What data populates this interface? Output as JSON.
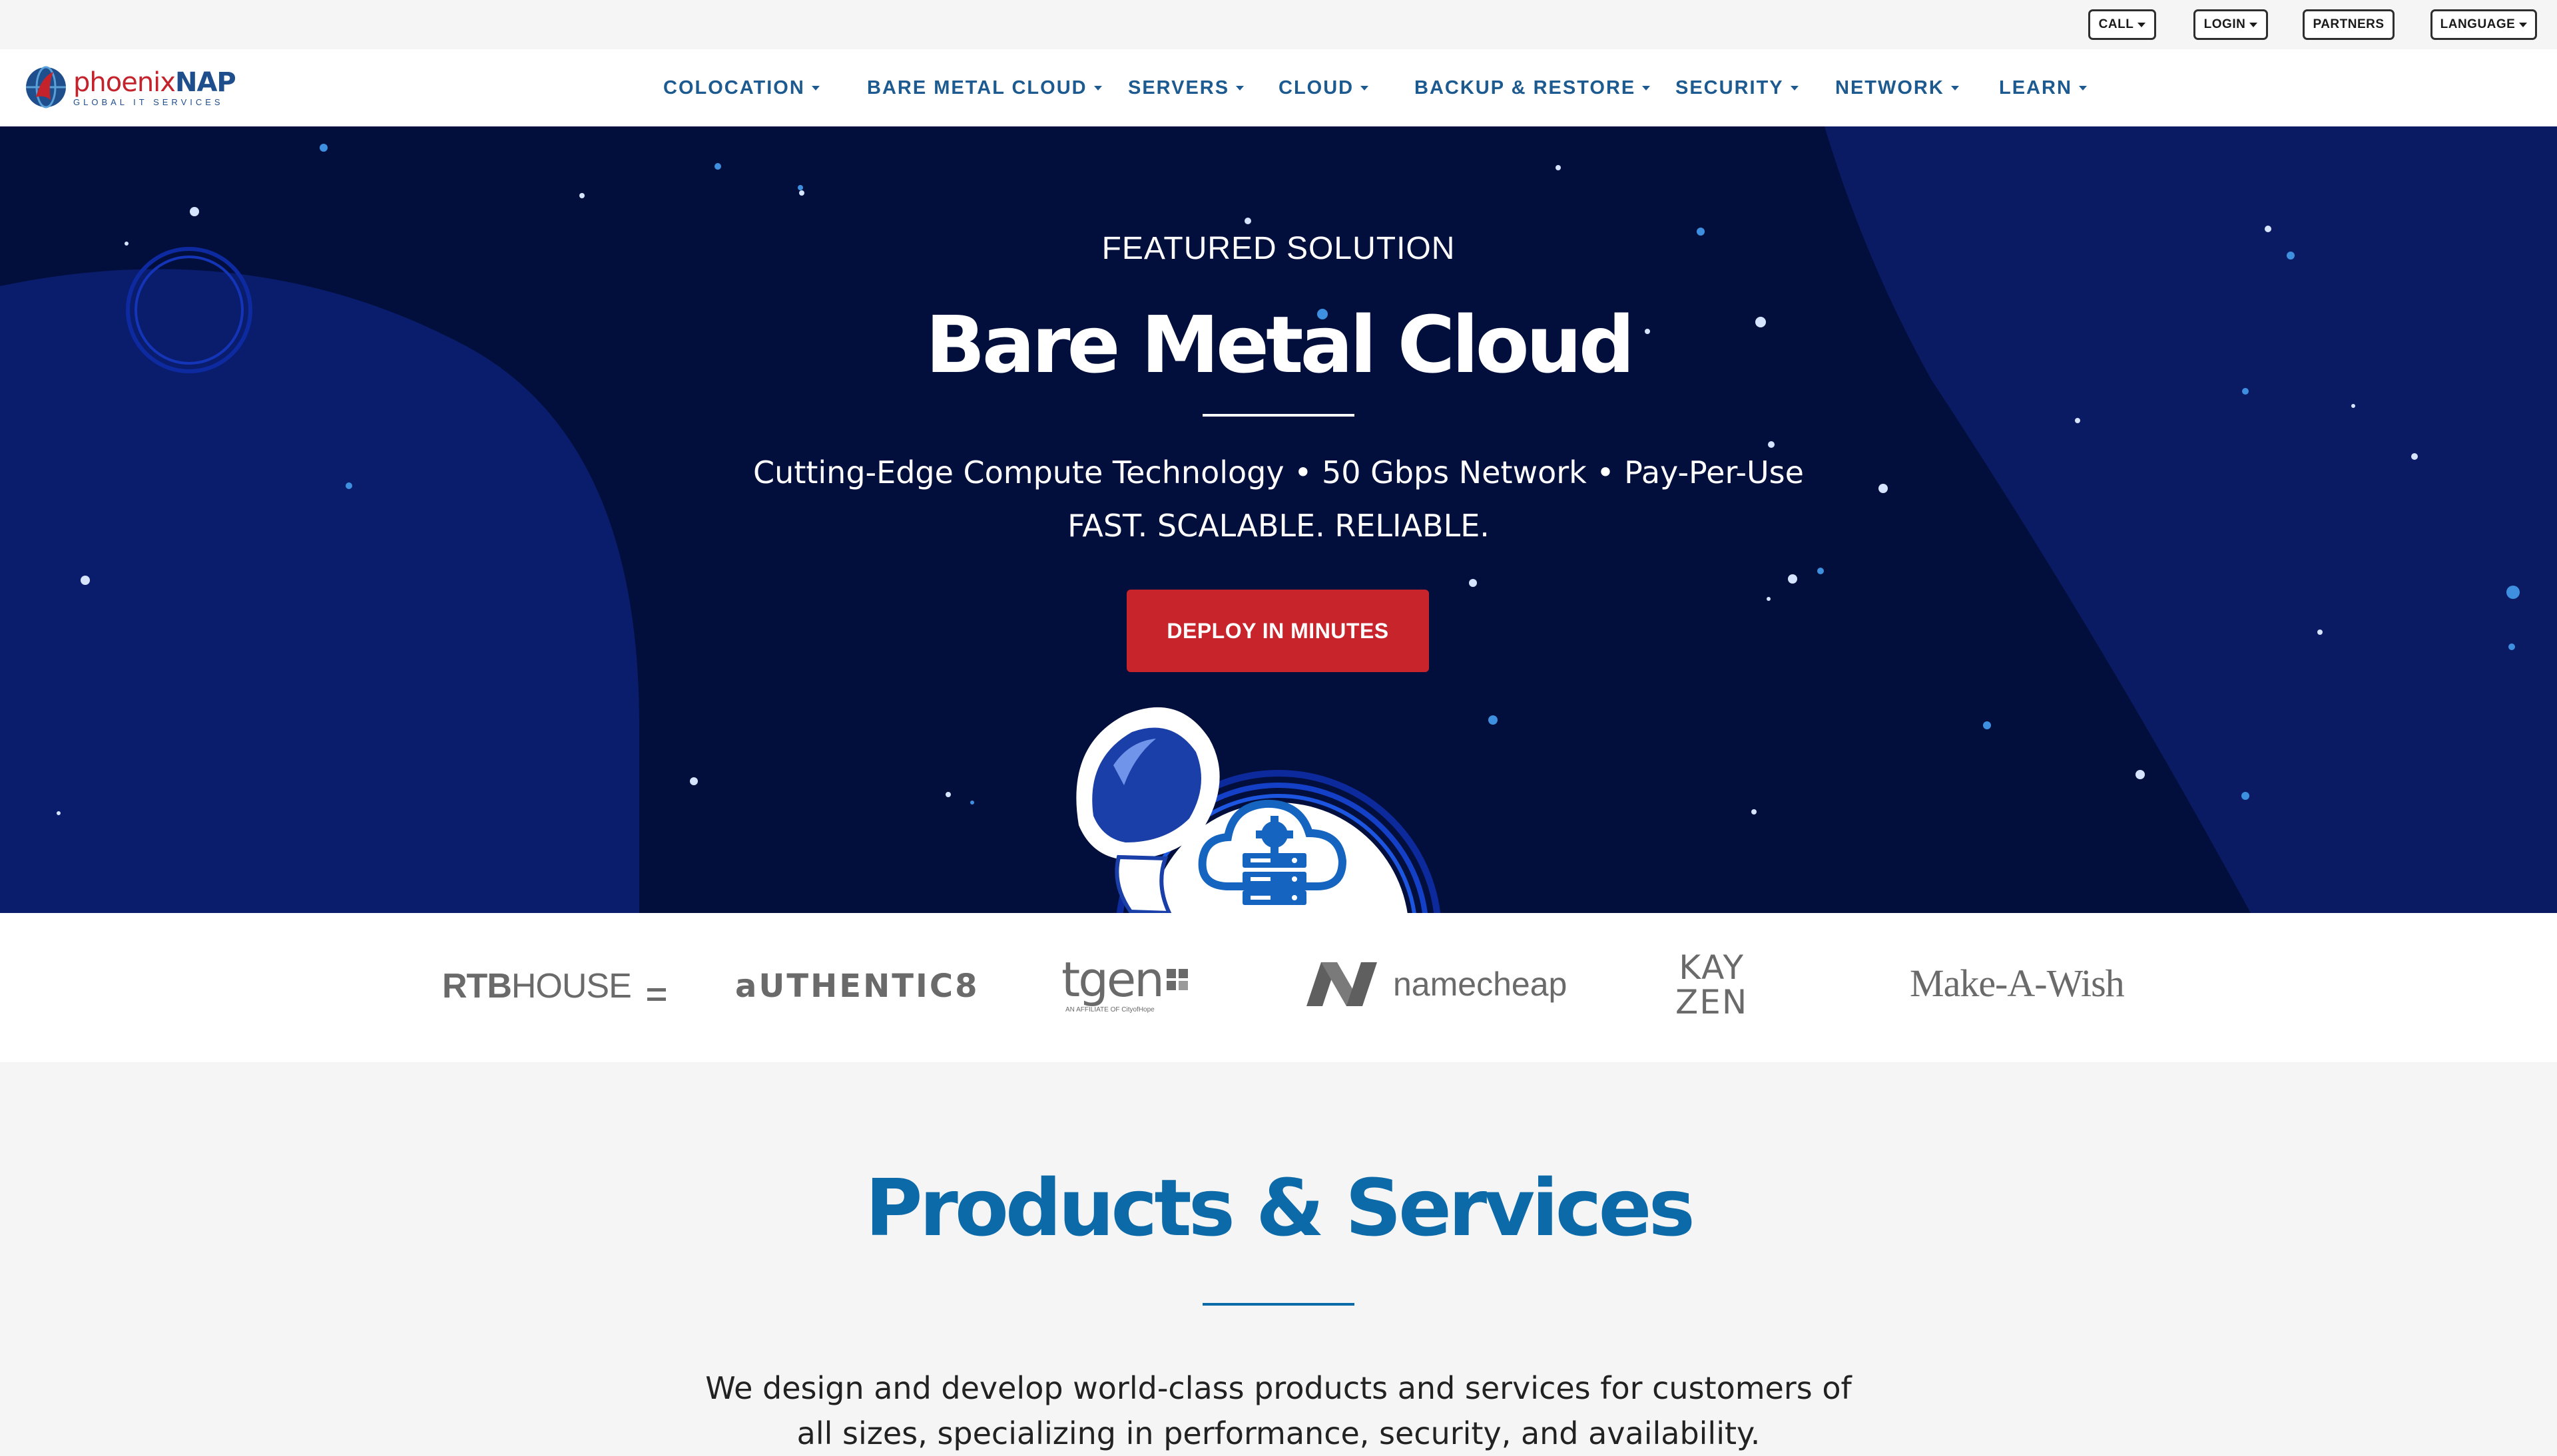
{
  "utility_bar": {
    "call_label": "CALL",
    "login_label": "LOGIN",
    "partners_label": "PARTNERS",
    "language_label": "LANGUAGE"
  },
  "brand": {
    "name_part1": "phoenix",
    "name_part2": "NAP",
    "tagline": "GLOBAL IT SERVICES",
    "primary_color": "#1d5a90",
    "accent_color": "#c4232b"
  },
  "nav": {
    "items": [
      {
        "label": "COLOCATION"
      },
      {
        "label": "BARE METAL CLOUD"
      },
      {
        "label": "SERVERS"
      },
      {
        "label": "CLOUD"
      },
      {
        "label": "BACKUP & RESTORE"
      },
      {
        "label": "SECURITY"
      },
      {
        "label": "NETWORK"
      },
      {
        "label": "LEARN"
      }
    ]
  },
  "hero": {
    "eyebrow": "FEATURED SOLUTION",
    "title": "Bare Metal Cloud",
    "subtitle_line1": "Cutting-Edge Compute Technology • 50 Gbps Network • Pay-Per-Use",
    "subtitle_line2": "FAST. SCALABLE. RELIABLE.",
    "cta_label": "DEPLOY IN MINUTES",
    "background_color": "#020f3c",
    "cta_color": "#c8242b"
  },
  "clients": [
    {
      "name": "RTB HOUSE",
      "part1": "RTB",
      "part2": "HOUSE"
    },
    {
      "name": "authentic8",
      "text": "aUTHENTIC8"
    },
    {
      "name": "tgen",
      "text": "tgen",
      "small": "AN AFFILIATE OF CityofHope"
    },
    {
      "name": "namecheap",
      "text": "namecheap"
    },
    {
      "name": "KAYZEN",
      "line1": "KAY",
      "line2": "ZEN"
    },
    {
      "name": "Make-A-Wish",
      "text": "Make-A-Wish"
    }
  ],
  "products": {
    "title": "Products & Services",
    "description": "We design and develop world-class products and services for customers of all sizes, specializing in performance, security, and availability."
  }
}
